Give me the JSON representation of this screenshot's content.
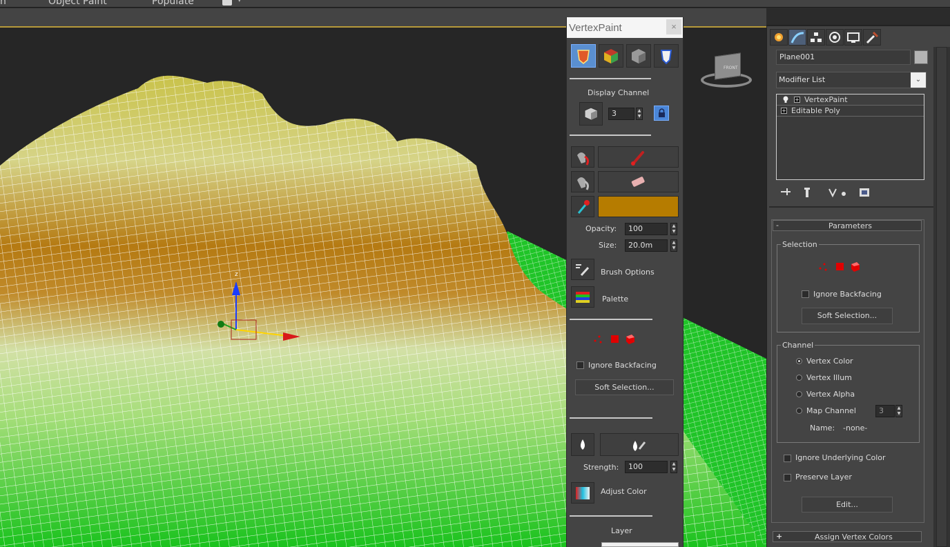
{
  "ribbon": {
    "item_1": "n",
    "item_2": "Object Paint",
    "item_3": "Populate"
  },
  "colors": {
    "accent": "#b79a3a",
    "paint_color": "#b67c00",
    "selection_red": "#e00000",
    "active_tool": "#5a8fd0"
  },
  "vertexpaint": {
    "title": "VertexPaint",
    "close": "×",
    "tools": [
      "paint-all-icon",
      "color-cube-icon",
      "grey-cube-icon",
      "shield-icon"
    ],
    "display_channel_label": "Display Channel",
    "display_channel_value": "3",
    "opacity_label": "Opacity:",
    "opacity_value": "100",
    "size_label": "Size:",
    "size_value": "20.0m",
    "brush_options_label": "Brush Options",
    "palette_label": "Palette",
    "ignore_backfacing_label": "Ignore Backfacing",
    "soft_selection_label": "Soft Selection...",
    "strength_label": "Strength:",
    "strength_value": "100",
    "adjust_color_label": "Adjust Color",
    "layer_label": "Layer"
  },
  "command_panel": {
    "tabs": [
      "create-tab-icon",
      "modify-tab-icon",
      "hierarchy-tab-icon",
      "motion-tab-icon",
      "display-tab-icon",
      "utilities-tab-icon"
    ],
    "object_name": "Plane001",
    "modifier_list_label": "Modifier List",
    "stack": [
      "VertexPaint",
      "Editable Poly"
    ],
    "parameters_header": "Parameters",
    "parameters_collapse": "-",
    "selection_group": "Selection",
    "ignore_backfacing_label": "Ignore Backfacing",
    "soft_selection_label": "Soft Selection...",
    "channel_group": "Channel",
    "channel_options": [
      "Vertex Color",
      "Vertex Illum",
      "Vertex Alpha",
      "Map Channel"
    ],
    "map_channel_value": "3",
    "name_label": "Name:",
    "name_value": "-none-",
    "ignore_underlying_label": "Ignore Underlying Color",
    "preserve_layer_label": "Preserve Layer",
    "edit_label": "Edit...",
    "assign_header": "Assign Vertex Colors",
    "assign_expand": "+"
  },
  "viewcube": {
    "face_label": "FRONT"
  }
}
